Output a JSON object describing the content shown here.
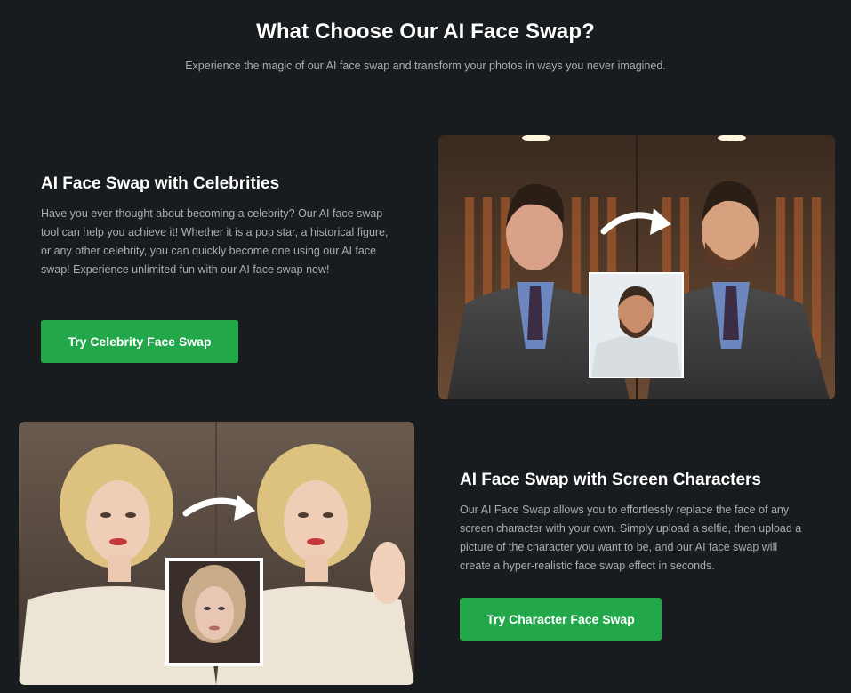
{
  "header": {
    "title": "What Choose Our AI Face Swap?",
    "subtitle": "Experience the magic of our AI face swap and transform your photos in ways you never imagined."
  },
  "features": [
    {
      "title": "AI Face Swap with Celebrities",
      "description": "Have you ever thought about becoming a celebrity? Our AI face swap tool can help you achieve it! Whether it is a pop star, a historical figure, or any other celebrity, you can quickly become one using our AI face swap! Experience unlimited fun with our AI face swap now!",
      "button_label": "Try Celebrity Face Swap"
    },
    {
      "title": "AI Face Swap with Screen Characters",
      "description": "Our AI Face Swap allows you to effortlessly replace the face of any screen character with your own. Simply upload a selfie, then upload a picture of the character you want to be, and our AI face swap will create a hyper-realistic face swap effect in seconds.",
      "button_label": "Try Character Face Swap"
    }
  ],
  "colors": {
    "background": "#181c1f",
    "accent": "#22a74a",
    "muted_text": "#a9adb1"
  }
}
